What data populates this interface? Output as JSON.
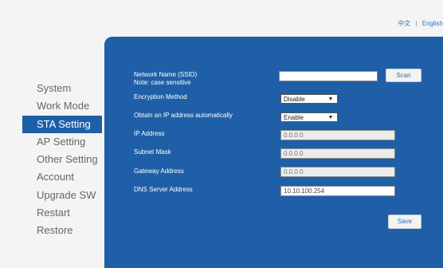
{
  "lang": {
    "chinese": "中文",
    "separator": "|",
    "english": "English"
  },
  "sidebar": {
    "items": [
      {
        "label": "System"
      },
      {
        "label": "Work Mode"
      },
      {
        "label": "STA Setting",
        "active": true
      },
      {
        "label": "AP Setting"
      },
      {
        "label": "Other Setting"
      },
      {
        "label": "Account"
      },
      {
        "label": "Upgrade SW"
      },
      {
        "label": "Restart"
      },
      {
        "label": "Restore"
      }
    ]
  },
  "form": {
    "ssid": {
      "label": "Network Name (SSID)",
      "note": "Note: case sensitive",
      "value": ""
    },
    "scan_button": "Scan",
    "encryption": {
      "label": "Encryption Method",
      "value": "Disable"
    },
    "dhcp": {
      "label": "Obtain an IP address automatically",
      "value": "Enable"
    },
    "ip": {
      "label": "IP Address",
      "value": "0.0.0.0"
    },
    "subnet": {
      "label": "Subnet Mask",
      "value": "0.0.0.0"
    },
    "gateway": {
      "label": "Gateway Address",
      "value": "0.0.0.0"
    },
    "dns": {
      "label": "DNS Server Address",
      "value": "10.10.100.254"
    },
    "save_button": "Save"
  },
  "colors": {
    "panel": "#1e5fa8",
    "active_nav": "#1e5fa8",
    "link": "#2c7bc0"
  }
}
